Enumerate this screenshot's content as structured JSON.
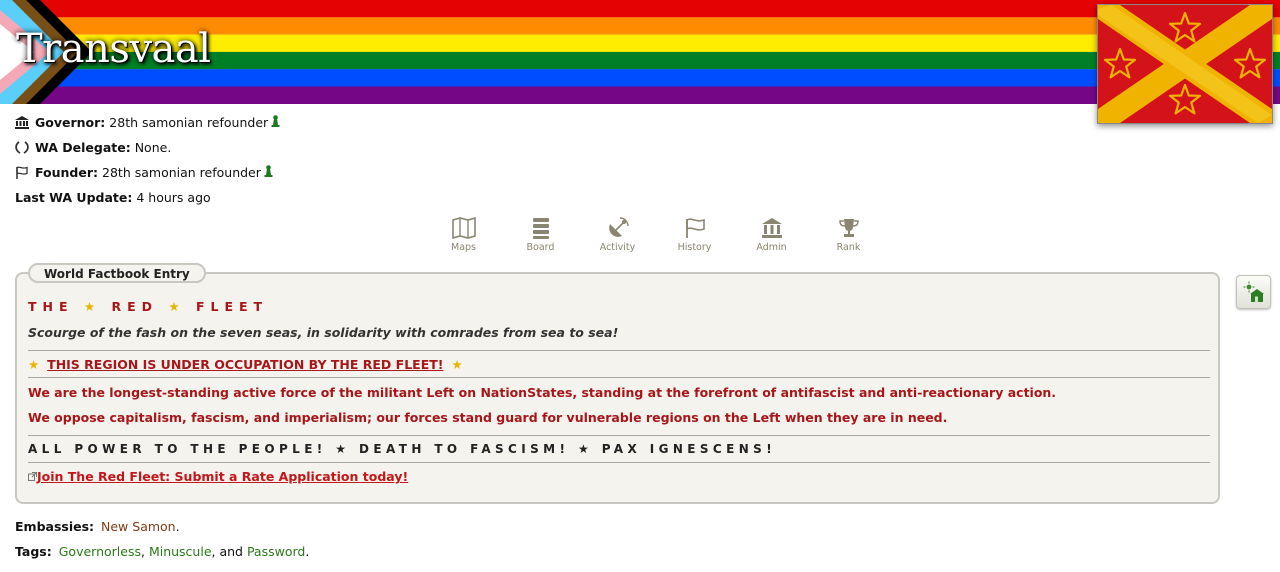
{
  "region": {
    "title": "Transvaal"
  },
  "info": {
    "governor_label": "Governor:",
    "governor_value": "28th samonian refounder",
    "delegate_label": "WA Delegate:",
    "delegate_value": "None.",
    "founder_label": "Founder:",
    "founder_value": "28th samonian refounder",
    "update_label": "Last WA Update:",
    "update_value": "4 hours ago"
  },
  "nav": {
    "items": [
      {
        "label": "Maps",
        "icon": "map-icon"
      },
      {
        "label": "Board",
        "icon": "board-icon"
      },
      {
        "label": "Activity",
        "icon": "satellite-icon"
      },
      {
        "label": "History",
        "icon": "flag-icon"
      },
      {
        "label": "Admin",
        "icon": "building-icon"
      },
      {
        "label": "Rank",
        "icon": "trophy-icon"
      }
    ]
  },
  "factbook": {
    "legend": "World Factbook Entry",
    "heading_word1": "THE",
    "heading_word2": "RED",
    "heading_word3": "FLEET",
    "star": "★",
    "subtitle": "Scourge of the fash on the seven seas, in solidarity with comrades from sea to sea!",
    "occupation": "THIS REGION IS UNDER OCCUPATION BY THE RED FLEET!",
    "line1": "We are the longest-standing active force of the militant Left on NationStates, standing at the forefront of antifascist and anti-reactionary action.",
    "line2": "We oppose capitalism, fascism, and imperialism; our forces stand guard for vulnerable regions on the Left when they are in need.",
    "power1": "ALL POWER TO THE PEOPLE!",
    "power2": "DEATH TO FASCISM!",
    "power3": "PAX IGNESCENS!",
    "join_link": "Join The Red Fleet: Submit a Rate Application today!"
  },
  "embassies": {
    "label": "Embassies:",
    "value": "New Samon",
    "end": "."
  },
  "tags": {
    "label": "Tags:",
    "tag1": "Governorless",
    "sep1": ", ",
    "tag2": "Minuscule",
    "sep2": ", and ",
    "tag3": "Password",
    "end": "."
  },
  "colors": {
    "factbook_red": "#a8161a",
    "star_gold": "#e8b400",
    "tag_green": "#2a7a18",
    "embassy_brown": "#7a3a16"
  }
}
